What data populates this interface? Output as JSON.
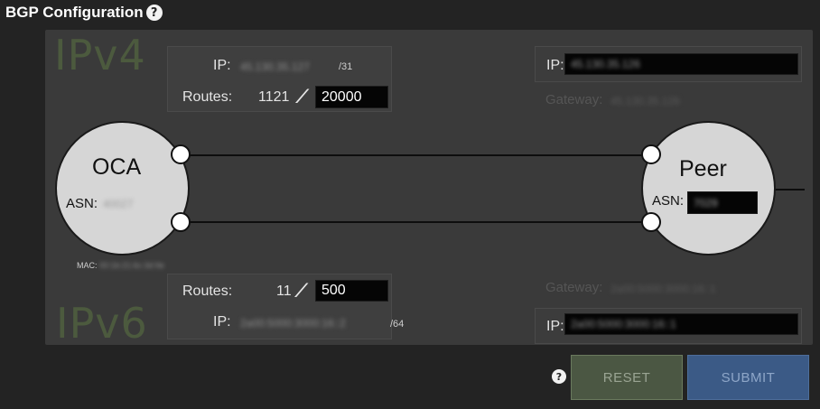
{
  "header": {
    "title": "BGP Configuration",
    "help_glyph": "?"
  },
  "watermarks": {
    "ipv4": "IPv4",
    "ipv6": "IPv6"
  },
  "ipv4": {
    "ip_label": "IP:",
    "ip_value": "45.130.35.127",
    "prefix": "/31",
    "routes_label": "Routes:",
    "routes_count": "1121",
    "routes_max": "20000",
    "peer_ip_label": "IP:",
    "peer_ip_value": "45.130.35.126",
    "gateway_label": "Gateway:",
    "gateway_value": "45.130.35.126"
  },
  "ipv6": {
    "routes_label": "Routes:",
    "routes_count": "11",
    "routes_max": "500",
    "ip_label": "IP:",
    "ip_value": "2a00:5000:3000:16::2",
    "prefix": "/64",
    "gateway_label": "Gateway:",
    "gateway_value": "2a00:5000:3000:16::1",
    "peer_ip_label": "IP:",
    "peer_ip_value": "2a00:5000:3000:16::1"
  },
  "oca": {
    "name": "OCA",
    "asn_label": "ASN:",
    "asn_value": "40027",
    "mac_label": "MAC:",
    "mac_value": "00:1b:21:6c:3d:9e"
  },
  "peer": {
    "name": "Peer",
    "asn_label": "ASN:",
    "asn_value": "7029"
  },
  "actions": {
    "help_glyph": "?",
    "reset_label": "RESET",
    "submit_label": "SUBMIT"
  }
}
